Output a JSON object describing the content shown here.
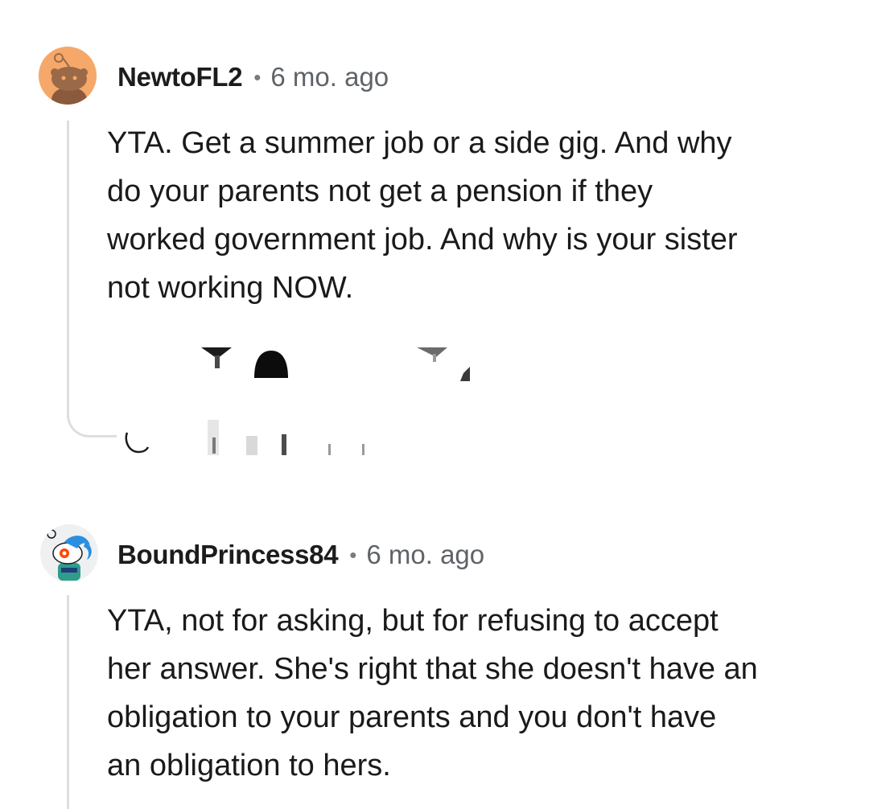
{
  "comments": [
    {
      "username": "NewtoFL2",
      "separator": "•",
      "time": "6 mo. ago",
      "text": "YTA. Get a summer job or a side gig. And why\ndo your parents not get a pension if they\nworked government job. And why is your sister\nnot working NOW."
    },
    {
      "username": "BoundPrincess84",
      "separator": "•",
      "time": "6 mo. ago",
      "text": "YTA, not for asking, but for refusing to accept\nher answer. She's right that she doesn't have an\nobligation to your parents and you don't have\nan obligation to hers."
    }
  ],
  "icons": {
    "avatar1": "snoo-avatar-icon",
    "avatar2": "snoo-avatar-icon",
    "upvote": "upvote-icon",
    "award": "award-icon",
    "downvote": "downvote-icon",
    "reply": "reply-icon"
  },
  "colors": {
    "avatar1_bg": "#f5a86a",
    "avatar2_bg": "#eef0f2",
    "thread_line": "#dedede",
    "text": "#1a1a1a",
    "meta": "#5f6368"
  }
}
